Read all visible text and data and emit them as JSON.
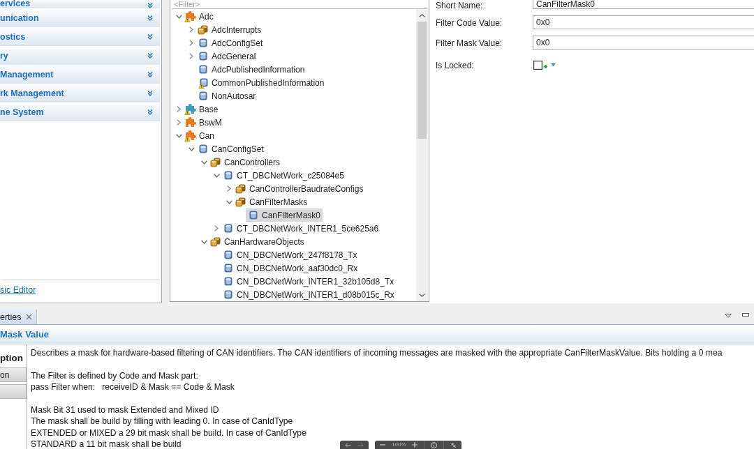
{
  "sidebar": {
    "sections": [
      {
        "label": "ervices",
        "expanded": false
      },
      {
        "label": "unication",
        "expanded": false
      },
      {
        "label": "ostics",
        "expanded": false
      },
      {
        "label": "ry",
        "expanded": false
      },
      {
        "label": "Management",
        "expanded": false
      },
      {
        "label": "rk Management",
        "expanded": false
      },
      {
        "label": "ne System",
        "expanded": false
      }
    ],
    "link": "sic Editor"
  },
  "tree": {
    "filter": {
      "placeholder": "<Filter>"
    },
    "nodes": [
      {
        "label": "Adc",
        "kind": "module",
        "color": "#ee7b22",
        "warning": true,
        "expanded": true,
        "selected": false,
        "children": [
          {
            "label": "AdcInterrupts",
            "kind": "group",
            "warning": false,
            "expanded": false,
            "selected": false
          },
          {
            "label": "AdcConfigSet",
            "kind": "container",
            "warning": false,
            "expanded": false,
            "selected": false
          },
          {
            "label": "AdcGeneral",
            "kind": "container",
            "warning": false,
            "expanded": false,
            "selected": false
          },
          {
            "label": "AdcPublishedInformation",
            "kind": "container",
            "warning": false,
            "selected": false
          },
          {
            "label": "CommonPublishedInformation",
            "kind": "container",
            "warning": true,
            "selected": false
          },
          {
            "label": "NonAutosar",
            "kind": "container",
            "warning": false,
            "selected": false
          }
        ]
      },
      {
        "label": "Base",
        "kind": "module",
        "color": "#3a9fb6",
        "warning": true,
        "expanded": false,
        "selected": false
      },
      {
        "label": "BswM",
        "kind": "module",
        "color": "#ee7b22",
        "warning": false,
        "expanded": false,
        "selected": false
      },
      {
        "label": "Can",
        "kind": "module",
        "color": "#ee7b22",
        "warning": true,
        "expanded": true,
        "selected": false,
        "children": [
          {
            "label": "CanConfigSet",
            "kind": "container",
            "warning": false,
            "expanded": true,
            "selected": false,
            "children": [
              {
                "label": "CanControllers",
                "kind": "group",
                "warning": false,
                "expanded": true,
                "selected": false,
                "children": [
                  {
                    "label": "CT_DBCNetWork_c25084e5",
                    "kind": "container",
                    "warning": false,
                    "expanded": true,
                    "selected": false,
                    "children": [
                      {
                        "label": "CanControllerBaudrateConfigs",
                        "kind": "group",
                        "warning": false,
                        "expanded": false,
                        "selected": false
                      },
                      {
                        "label": "CanFilterMasks",
                        "kind": "group",
                        "warning": false,
                        "expanded": true,
                        "selected": false,
                        "children": [
                          {
                            "label": "CanFilterMask0",
                            "kind": "container",
                            "warning": false,
                            "selected": true
                          }
                        ]
                      }
                    ]
                  },
                  {
                    "label": "CT_DBCNetWork_INTER1_5ce625a6",
                    "kind": "container",
                    "warning": false,
                    "expanded": false,
                    "selected": false
                  }
                ]
              },
              {
                "label": "CanHardwareObjects",
                "kind": "group",
                "warning": false,
                "expanded": true,
                "selected": false,
                "children": [
                  {
                    "label": "CN_DBCNetWork_247f8178_Tx",
                    "kind": "container",
                    "warning": false,
                    "selected": false
                  },
                  {
                    "label": "CN_DBCNetWork_aaf30dc0_Rx",
                    "kind": "container",
                    "warning": false,
                    "selected": false
                  },
                  {
                    "label": "CN_DBCNetWork_INTER1_32b105d8_Tx",
                    "kind": "container",
                    "warning": false,
                    "selected": false
                  },
                  {
                    "label": "CN_DBCNetWork_INTER1_d08b015c_Rx",
                    "kind": "container",
                    "warning": false,
                    "selected": false
                  }
                ]
              }
            ]
          }
        ]
      }
    ]
  },
  "form": {
    "fields": [
      {
        "label": "Short Name:",
        "kind": "text",
        "value": "CanFilterMask0"
      },
      {
        "label": "Filter Code Value:",
        "kind": "text",
        "value": "0x0"
      },
      {
        "label": "Filter Mask Value:",
        "kind": "text",
        "value": "0x0"
      },
      {
        "label": "Is Locked:",
        "kind": "checkbox",
        "checked": false
      }
    ]
  },
  "properties": {
    "tabs": [
      {
        "label": "erties",
        "selected": true
      }
    ],
    "title": "Mask Value",
    "side_tabs": [
      {
        "label": "ption",
        "selected": true
      },
      {
        "label": "on",
        "selected": false
      },
      {
        "selected": false
      }
    ],
    "description": [
      "Describes a mask for hardware-based filtering of CAN identifiers. The CAN identifiers of incoming messages are masked with the appropriate CanFilterMaskValue. Bits holding a 0 mea",
      "The Filter is defined by Code and Mask part:\npass Filter when:   receiveID & Mask == Code & Mask",
      "Mask Bit 31 used to mask Extended and Mixed ID\nThe mask shall be build by filling with leading 0. In case of CanIdType\nEXTENDED or MIXED a 29 bit mask shall be build. In case of CanIdType\nSTANDARD a 11 bit mask shall be build"
    ]
  },
  "viewer_toolbar": {
    "zoom": "100%"
  }
}
